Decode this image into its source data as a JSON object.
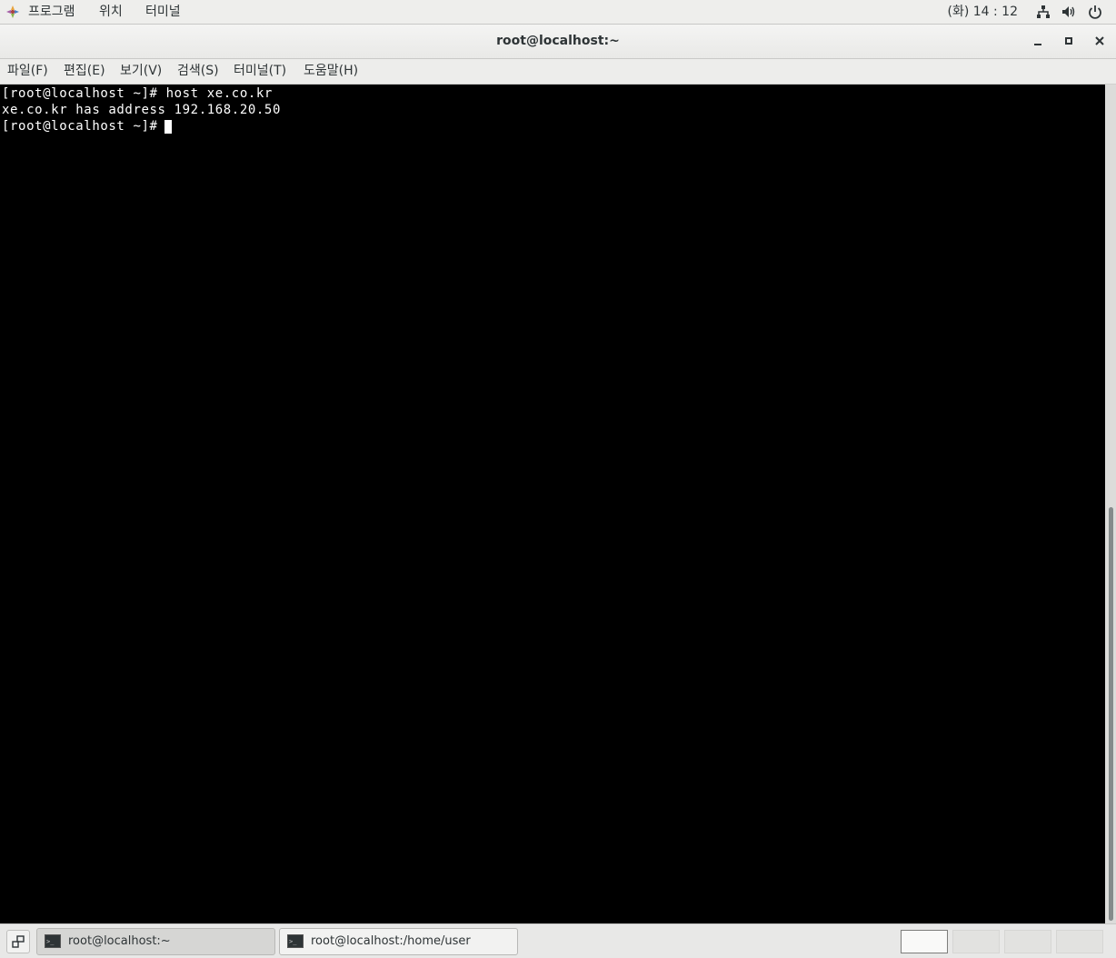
{
  "top_panel": {
    "menus": [
      "프로그램",
      "위치",
      "터미널"
    ],
    "clock": "(화) 14 : 12",
    "icons": [
      "network-icon",
      "volume-icon",
      "power-icon"
    ]
  },
  "window": {
    "title": "root@localhost:~",
    "buttons": [
      "minimize",
      "maximize",
      "close"
    ]
  },
  "menubar": {
    "items": [
      "파일(F)",
      "편집(E)",
      "보기(V)",
      "검색(S)",
      "터미널(T)",
      "도움말(H)"
    ]
  },
  "terminal": {
    "lines": [
      "[root@localhost ~]# host xe.co.kr",
      "xe.co.kr has address 192.168.20.50",
      "[root@localhost ~]# "
    ]
  },
  "taskbar": {
    "tasks": [
      {
        "label": "root@localhost:~",
        "active": true
      },
      {
        "label": "root@localhost:/home/user",
        "active": false
      }
    ],
    "workspaces": 4,
    "active_workspace": 1
  },
  "colors": {
    "terminal_bg": "#000000",
    "terminal_fg": "#ffffff",
    "panel_bg": "#eeeeec"
  }
}
